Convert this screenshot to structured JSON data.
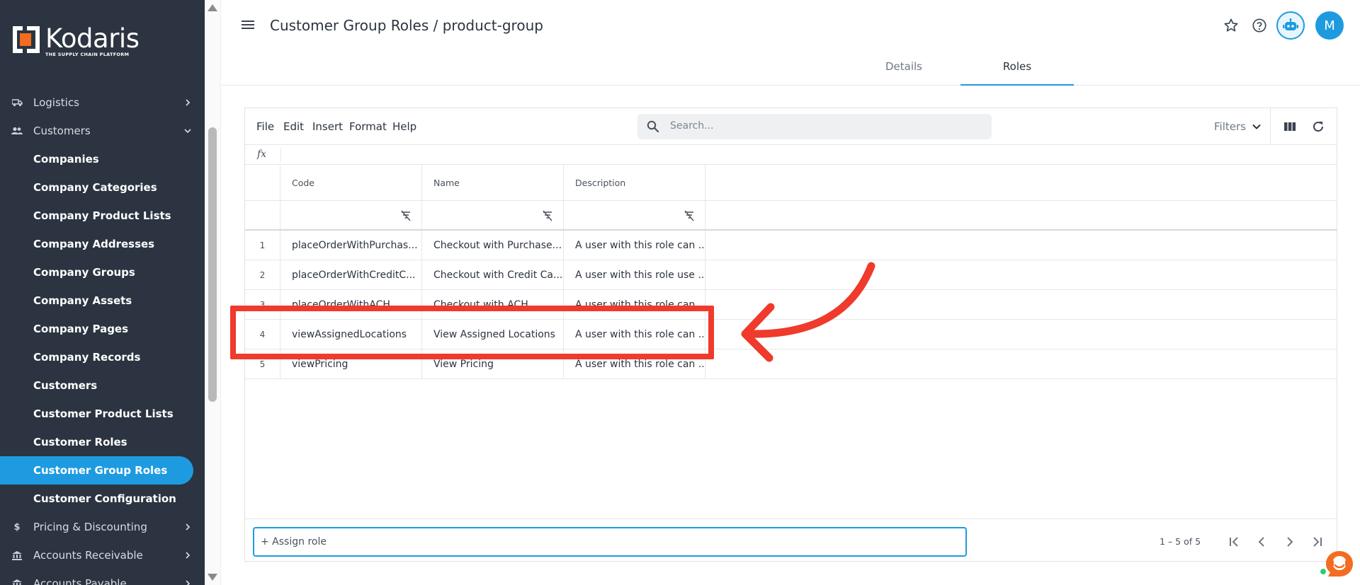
{
  "brand": {
    "name": "Kodaris",
    "tagline": "THE SUPPLY CHAIN PLATFORM",
    "accent": "#1e9be0",
    "sidebar_bg": "#2b3440",
    "logo_orange": "#f26c21"
  },
  "sidebar": {
    "sections": [
      {
        "label": "Logistics",
        "icon": "truck-icon",
        "expanded": false
      },
      {
        "label": "Customers",
        "icon": "people-icon",
        "expanded": true
      },
      {
        "label": "Pricing & Discounting",
        "icon": "dollar-icon",
        "expanded": false
      },
      {
        "label": "Accounts Receivable",
        "icon": "bank-icon",
        "expanded": false
      },
      {
        "label": "Accounts Payable",
        "icon": "bank-icon",
        "expanded": false
      }
    ],
    "customer_items": [
      "Companies",
      "Company Categories",
      "Company Product Lists",
      "Company Addresses",
      "Company Groups",
      "Company Assets",
      "Company Pages",
      "Company Records",
      "Customers",
      "Customer Product Lists",
      "Customer Roles",
      "Customer Group Roles",
      "Customer Configuration"
    ],
    "active_item": "Customer Group Roles"
  },
  "header": {
    "title": "Customer Group Roles / product-group",
    "avatar_initial": "M",
    "tabs": [
      {
        "label": "Details",
        "active": false
      },
      {
        "label": "Roles",
        "active": true
      }
    ]
  },
  "toolbar": {
    "menus": [
      "File",
      "Edit",
      "Insert",
      "Format",
      "Help"
    ],
    "search_placeholder": "Search...",
    "filters_label": "Filters"
  },
  "formula_bar": {
    "label": "fx"
  },
  "table": {
    "columns": [
      "Code",
      "Name",
      "Description"
    ],
    "rows": [
      {
        "num": "1",
        "code": "placeOrderWithPurchas...",
        "name": "Checkout with Purchase...",
        "description": "A user with this role can ..."
      },
      {
        "num": "2",
        "code": "placeOrderWithCreditC...",
        "name": "Checkout with Credit Ca...",
        "description": "A user with this role use ..."
      },
      {
        "num": "3",
        "code": "placeOrderWithACH",
        "name": "Checkout with ACH",
        "description": "A user with this role can ..."
      },
      {
        "num": "4",
        "code": "viewAssignedLocations",
        "name": "View Assigned Locations",
        "description": "A user with this role can ..."
      },
      {
        "num": "5",
        "code": "viewPricing",
        "name": "View Pricing",
        "description": "A user with this role can ..."
      }
    ],
    "highlighted_row": "4"
  },
  "footer": {
    "assign_placeholder": "+ Assign role",
    "pagination": "1 – 5 of 5"
  },
  "annotation": {
    "color": "#ef3a2c"
  }
}
